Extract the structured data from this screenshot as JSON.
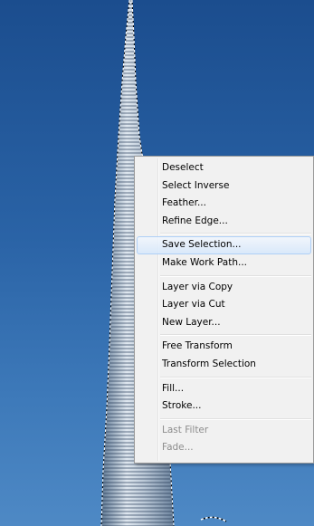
{
  "context_menu": {
    "groups": [
      [
        "Deselect",
        "Select Inverse",
        "Feather...",
        "Refine Edge..."
      ],
      [
        "Save Selection...",
        "Make Work Path..."
      ],
      [
        "Layer via Copy",
        "Layer via Cut",
        "New Layer..."
      ],
      [
        "Free Transform",
        "Transform Selection"
      ],
      [
        "Fill...",
        "Stroke..."
      ],
      [
        "Last Filter",
        "Fade..."
      ]
    ],
    "hovered_item": "Save Selection...",
    "disabled_items": [
      "Last Filter",
      "Fade..."
    ]
  },
  "colors": {
    "sky_top": "#1b4d8e",
    "sky_bottom": "#4e89c5",
    "menu_background": "#f1f1f1",
    "hover_highlight": "#d5e7fb",
    "disabled_text": "#8d8d8d"
  }
}
